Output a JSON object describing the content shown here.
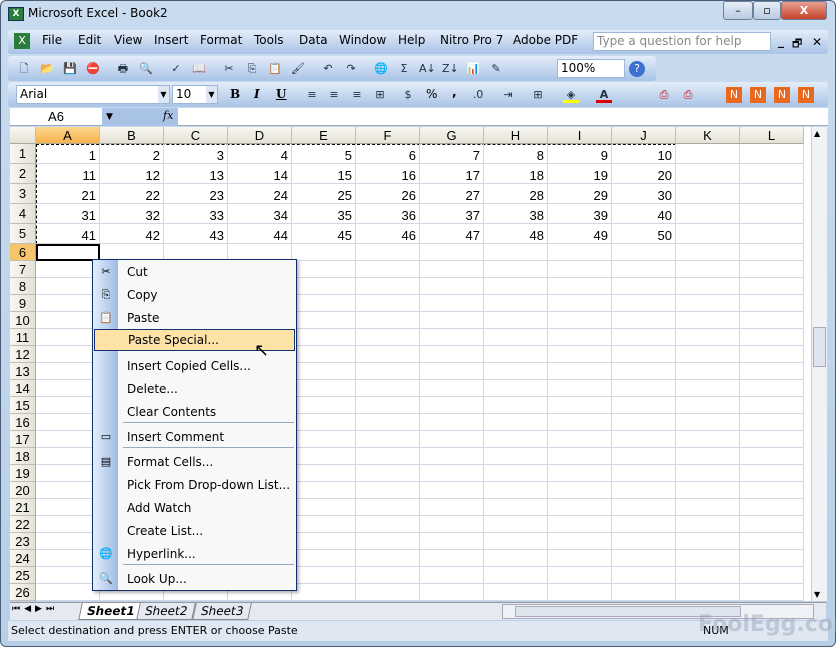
{
  "window": {
    "title": "Microsoft Excel - Book2",
    "minimize": "–",
    "restore": "▫",
    "close": "X"
  },
  "menu": {
    "items": [
      "File",
      "Edit",
      "View",
      "Insert",
      "Format",
      "Tools",
      "Data",
      "Window",
      "Help",
      "Nitro Pro 7",
      "Adobe PDF"
    ],
    "help_placeholder": "Type a question for help",
    "doc_min": "_",
    "doc_restore": "🗗",
    "doc_close": "✕"
  },
  "toolbar": {
    "zoom": "100%",
    "icons": [
      "new",
      "open",
      "save",
      "permission",
      "print",
      "print-preview",
      "spelling",
      "research",
      "cut",
      "copy",
      "paste",
      "format-painter",
      "undo",
      "redo",
      "hyperlink",
      "autosum",
      "sort-ascending",
      "sort-descending",
      "chart-wizard",
      "drawing"
    ]
  },
  "format_bar": {
    "font": "Arial",
    "size": "10",
    "bold": "B",
    "italic": "I",
    "underline": "U",
    "percent": "%",
    "comma": ","
  },
  "formula_bar": {
    "name_box": "A6",
    "fx": "fx",
    "value": ""
  },
  "columns": [
    "A",
    "B",
    "C",
    "D",
    "E",
    "F",
    "G",
    "H",
    "I",
    "J",
    "K",
    "L"
  ],
  "rows": [
    "1",
    "2",
    "3",
    "4",
    "5",
    "6",
    "7",
    "8",
    "9",
    "10",
    "11",
    "12",
    "13",
    "14",
    "15",
    "16",
    "17",
    "18",
    "19",
    "20",
    "21",
    "22",
    "23",
    "24",
    "25",
    "26"
  ],
  "cells": [
    [
      1,
      2,
      3,
      4,
      5,
      6,
      7,
      8,
      9,
      10
    ],
    [
      11,
      12,
      13,
      14,
      15,
      16,
      17,
      18,
      19,
      20
    ],
    [
      21,
      22,
      23,
      24,
      25,
      26,
      27,
      28,
      29,
      30
    ],
    [
      31,
      32,
      33,
      34,
      35,
      36,
      37,
      38,
      39,
      40
    ],
    [
      41,
      42,
      43,
      44,
      45,
      46,
      47,
      48,
      49,
      50
    ]
  ],
  "active_cell": "A6",
  "context_menu": {
    "items": [
      {
        "label": "Cut",
        "icon": "✂"
      },
      {
        "label": "Copy",
        "icon": "⎘"
      },
      {
        "label": "Paste",
        "icon": "📋"
      },
      {
        "label": "Paste Special...",
        "icon": "",
        "highlighted": true
      },
      {
        "label": "Insert Copied Cells...",
        "icon": ""
      },
      {
        "label": "Delete...",
        "icon": ""
      },
      {
        "label": "Clear Contents",
        "icon": ""
      },
      {
        "label": "Insert Comment",
        "icon": "▭",
        "sep_before": true
      },
      {
        "label": "Format Cells...",
        "icon": "▤",
        "sep_before": true
      },
      {
        "label": "Pick From Drop-down List...",
        "icon": ""
      },
      {
        "label": "Add Watch",
        "icon": ""
      },
      {
        "label": "Create List...",
        "icon": ""
      },
      {
        "label": "Hyperlink...",
        "icon": "🌐"
      },
      {
        "label": "Look Up...",
        "icon": "🔍",
        "sep_before": true
      }
    ]
  },
  "sheets": [
    "Sheet1",
    "Sheet2",
    "Sheet3"
  ],
  "active_sheet": "Sheet1",
  "status": {
    "message": "Select destination and press ENTER or choose Paste",
    "num": "NUM"
  },
  "watermark": "FoolEgg.com"
}
